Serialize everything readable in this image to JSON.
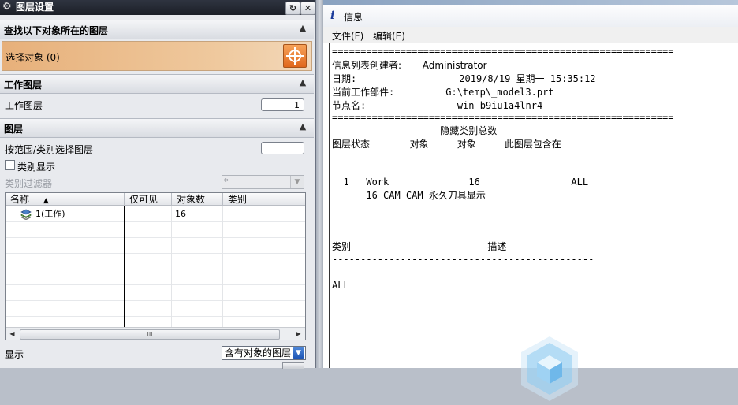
{
  "layer_dialog": {
    "title": "图层设置",
    "sections": {
      "find": "查找以下对象所在的图层",
      "select_object": "选择对象 (0)",
      "work_layer_head": "工作图层",
      "work_layer_label": "工作图层",
      "work_layer_value": "1",
      "layers_head": "图层",
      "range_label": "按范围/类别选择图层",
      "category_display": "类别显示",
      "category_filter_label": "类别过滤器",
      "category_filter_value": "*"
    },
    "table": {
      "columns": [
        "名称",
        "仅可见",
        "对象数",
        "类别"
      ],
      "sort_indicator": "▲",
      "rows": [
        {
          "name": "1(工作)",
          "visible_only": "",
          "object_count": "16",
          "category": ""
        }
      ],
      "scroll_grip": "III"
    },
    "display_label": "显示",
    "display_value": "含有对象的图层"
  },
  "info_window": {
    "title": "信息",
    "menu": [
      "文件(F)",
      "编辑(E)"
    ],
    "lines": [
      "============================================================",
      "信息列表创建者:       Administrator",
      "日期:                  2019/8/19 星期一 15:35:12",
      "当前工作部件:         G:\\temp\\_model3.prt",
      "节点名:                win-b9iu1a4lnr4",
      "============================================================",
      "                   隐藏类别总数",
      "图层状态       对象     对象     此图层包含在",
      "------------------------------------------------------------",
      "",
      "",
      "  1   Work              16                ALL",
      "      16 CAM CAM 永久刀具显示",
      "",
      "",
      "",
      "类别                        描述",
      "----------------------------------------------",
      "",
      "ALL"
    ]
  },
  "colors": {
    "title_bar": "#1c1f27",
    "select_row": "#efc99e",
    "select_button": "#e0671b",
    "combo_arrow": "#1e55b4",
    "watermark": "#6fb8ea"
  }
}
